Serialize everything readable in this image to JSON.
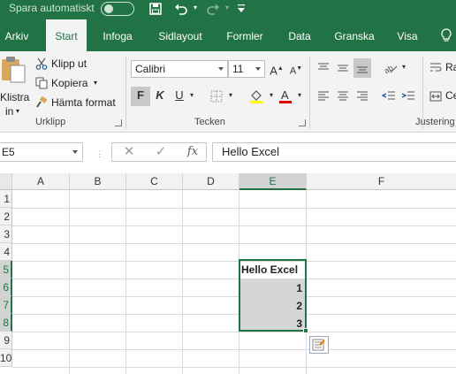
{
  "titlebar": {
    "autosave_label": "Spara automatiskt",
    "save_icon": "save-icon",
    "undo_icon": "undo-icon",
    "redo_icon": "redo-icon",
    "customize_icon": "customize-qat-icon"
  },
  "tabs": [
    {
      "label": "Arkiv"
    },
    {
      "label": "Start"
    },
    {
      "label": "Infoga"
    },
    {
      "label": "Sidlayout"
    },
    {
      "label": "Formler"
    },
    {
      "label": "Data"
    },
    {
      "label": "Granska"
    },
    {
      "label": "Visa"
    }
  ],
  "ribbon": {
    "clipboard": {
      "paste_label_line1": "Klistra",
      "paste_label_line2": "in",
      "cut_label": "Klipp ut",
      "copy_label": "Kopiera",
      "format_painter_label": "Hämta format",
      "group_label": "Urklipp"
    },
    "font": {
      "font_name": "Calibri",
      "font_size": "11",
      "bold": "F",
      "italic": "K",
      "underline": "U",
      "group_label": "Tecken"
    },
    "alignment": {
      "group_label": "Justering",
      "wrap_label": "Ra",
      "merge_label": "Ce"
    }
  },
  "formula_bar": {
    "name_box": "E5",
    "cancel_symbol": "✕",
    "enter_symbol": "✓",
    "fx_symbol": "fx",
    "formula": "Hello Excel"
  },
  "sheet": {
    "columns": [
      "A",
      "B",
      "C",
      "D",
      "E",
      "F"
    ],
    "rows": [
      "1",
      "2",
      "3",
      "4",
      "5",
      "6",
      "7",
      "8",
      "9",
      "10"
    ],
    "cells": {
      "E5": "Hello Excel",
      "E6": "1",
      "E7": "2",
      "E8": "3"
    }
  },
  "colors": {
    "brand": "#217346",
    "selection_fill": "#d6d6d6"
  }
}
